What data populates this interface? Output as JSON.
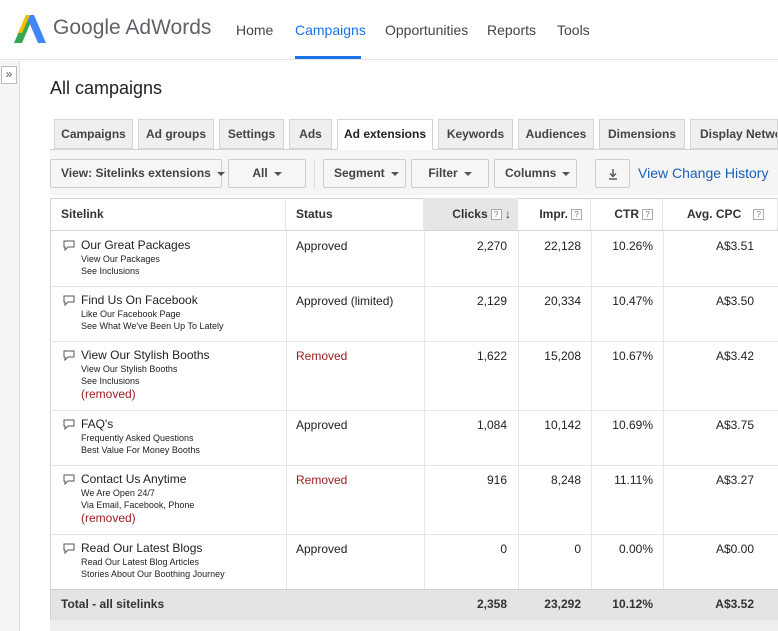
{
  "brand": {
    "name": "Google AdWords"
  },
  "nav": {
    "home": "Home",
    "campaigns": "Campaigns",
    "opportunities": "Opportunities",
    "reports": "Reports",
    "tools": "Tools"
  },
  "collapse_glyph": "»",
  "page_title": "All campaigns",
  "tabs": [
    "Campaigns",
    "Ad groups",
    "Settings",
    "Ads",
    "Ad extensions",
    "Keywords",
    "Audiences",
    "Dimensions",
    "Display Network"
  ],
  "active_tab": "Ad extensions",
  "toolbar": {
    "view": "View: Sitelinks extensions",
    "all": "All",
    "segment": "Segment",
    "filter": "Filter",
    "columns": "Columns",
    "download_icon": "download-icon",
    "history": "View Change History"
  },
  "columns": {
    "sitelink": "Sitelink",
    "status": "Status",
    "clicks": "Clicks",
    "impr": "Impr.",
    "ctr": "CTR",
    "avg_cpc": "Avg. CPC",
    "help": "?",
    "sort_arrow": "↓"
  },
  "rows": [
    {
      "title": "Our Great Packages",
      "line1": "View Our Packages",
      "line2": "See Inclusions",
      "removed": "",
      "status": "Approved",
      "clicks": "2,270",
      "impr": "22,128",
      "ctr": "10.26%",
      "cpc": "A$3.51"
    },
    {
      "title": "Find Us On Facebook",
      "line1": "Like Our Facebook Page",
      "line2": "See What We've Been Up To Lately",
      "removed": "",
      "status": "Approved (limited)",
      "clicks": "2,129",
      "impr": "20,334",
      "ctr": "10.47%",
      "cpc": "A$3.50"
    },
    {
      "title": "View Our Stylish Booths",
      "line1": "View Our Stylish Booths",
      "line2": "See Inclusions",
      "removed": "(removed)",
      "status": "Removed",
      "clicks": "1,622",
      "impr": "15,208",
      "ctr": "10.67%",
      "cpc": "A$3.42"
    },
    {
      "title": "FAQ's",
      "line1": "Frequently Asked Questions",
      "line2": "Best Value For Money Booths",
      "removed": "",
      "status": "Approved",
      "clicks": "1,084",
      "impr": "10,142",
      "ctr": "10.69%",
      "cpc": "A$3.75"
    },
    {
      "title": "Contact Us Anytime",
      "line1": "We Are Open 24/7",
      "line2": "Via Email, Facebook, Phone",
      "removed": "(removed)",
      "status": "Removed",
      "clicks": "916",
      "impr": "8,248",
      "ctr": "11.11%",
      "cpc": "A$3.27"
    },
    {
      "title": "Read Our Latest Blogs",
      "line1": "Read Our Latest Blog Articles",
      "line2": "Stories About Our Boothing Journey",
      "removed": "",
      "status": "Approved",
      "clicks": "0",
      "impr": "0",
      "ctr": "0.00%",
      "cpc": "A$0.00"
    }
  ],
  "total": {
    "label": "Total - all sitelinks",
    "clicks": "2,358",
    "impr": "23,292",
    "ctr": "10.12%",
    "cpc": "A$3.52"
  },
  "colors": {
    "accent": "#1a73e8",
    "removed": "#9b1c1c",
    "link": "#1a5fb4"
  }
}
